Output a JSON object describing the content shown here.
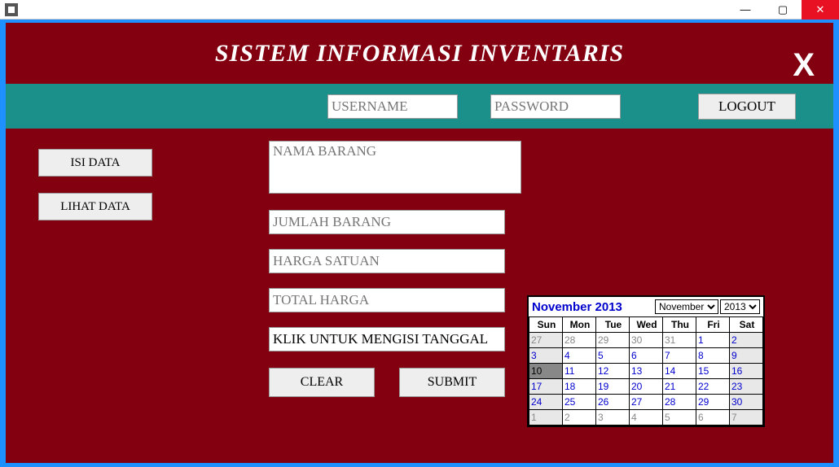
{
  "titlebar": {
    "min": "—",
    "max": "▢",
    "close": "✕"
  },
  "header": {
    "title": "SISTEM INFORMASI INVENTARIS",
    "close": "X"
  },
  "auth": {
    "username_ph": "USERNAME",
    "password_ph": "PASSWORD",
    "logout": "LOGOUT"
  },
  "side": {
    "isi": "ISI DATA",
    "lihat": "LIHAT DATA"
  },
  "form": {
    "nama_ph": "NAMA BARANG",
    "jumlah_ph": "JUMLAH BARANG",
    "harga_ph": "HARGA SATUAN",
    "total_ph": "TOTAL HARGA",
    "tanggal_val": "KLIK UNTUK MENGISI TANGGAL",
    "clear": "CLEAR",
    "submit": "SUBMIT"
  },
  "calendar": {
    "title": "November 2013",
    "month_sel": "November",
    "year_sel": "2013",
    "dow": [
      "Sun",
      "Mon",
      "Tue",
      "Wed",
      "Thu",
      "Fri",
      "Sat"
    ],
    "rows": [
      [
        {
          "d": "27",
          "o": true
        },
        {
          "d": "28",
          "o": true
        },
        {
          "d": "29",
          "o": true
        },
        {
          "d": "30",
          "o": true
        },
        {
          "d": "31",
          "o": true
        },
        {
          "d": "1"
        },
        {
          "d": "2"
        }
      ],
      [
        {
          "d": "3"
        },
        {
          "d": "4"
        },
        {
          "d": "5"
        },
        {
          "d": "6"
        },
        {
          "d": "7"
        },
        {
          "d": "8"
        },
        {
          "d": "9"
        }
      ],
      [
        {
          "d": "10",
          "today": true
        },
        {
          "d": "11"
        },
        {
          "d": "12"
        },
        {
          "d": "13"
        },
        {
          "d": "14"
        },
        {
          "d": "15"
        },
        {
          "d": "16"
        }
      ],
      [
        {
          "d": "17"
        },
        {
          "d": "18"
        },
        {
          "d": "19"
        },
        {
          "d": "20"
        },
        {
          "d": "21"
        },
        {
          "d": "22"
        },
        {
          "d": "23"
        }
      ],
      [
        {
          "d": "24"
        },
        {
          "d": "25"
        },
        {
          "d": "26"
        },
        {
          "d": "27"
        },
        {
          "d": "28"
        },
        {
          "d": "29"
        },
        {
          "d": "30"
        }
      ],
      [
        {
          "d": "1",
          "o": true
        },
        {
          "d": "2",
          "o": true
        },
        {
          "d": "3",
          "o": true
        },
        {
          "d": "4",
          "o": true
        },
        {
          "d": "5",
          "o": true
        },
        {
          "d": "6",
          "o": true
        },
        {
          "d": "7",
          "o": true
        }
      ]
    ]
  }
}
